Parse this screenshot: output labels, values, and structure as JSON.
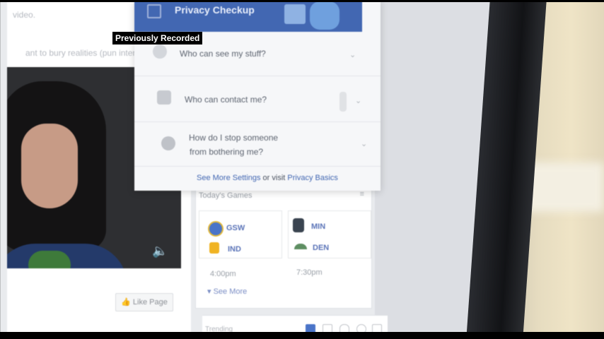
{
  "caption": "Previously Recorded",
  "news_feed": {
    "line1": "video.",
    "line2": "ant to bury realities (pun intended)",
    "like_page": "Like Page"
  },
  "privacy_checkup": {
    "title": "Privacy Checkup",
    "rows": [
      {
        "label": "Who can see my stuff?",
        "icon": "lock-icon"
      },
      {
        "label": "Who can contact me?",
        "icon": "people-icon"
      },
      {
        "label_line1": "How do I stop someone",
        "label_line2": "from bothering me?",
        "icon": "block-icon"
      }
    ],
    "footer_link1": "See More Settings",
    "footer_mid": " or visit ",
    "footer_link2": "Privacy Basics"
  },
  "todays_games": {
    "title": "Today's Games",
    "games": [
      {
        "team1": "GSW",
        "team2": "IND",
        "time": "4:00pm"
      },
      {
        "team1": "MIN",
        "team2": "DEN",
        "time": "7:30pm"
      }
    ],
    "see_more": "See More"
  },
  "trending": {
    "label": "Trending"
  },
  "colors": {
    "facebook_blue": "#4267b2",
    "link_blue": "#5b74b8"
  }
}
